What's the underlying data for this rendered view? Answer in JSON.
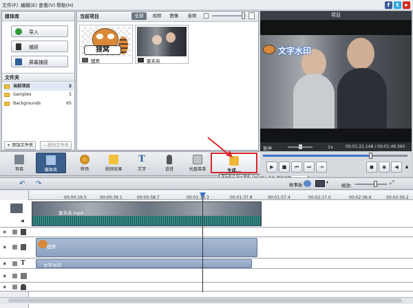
{
  "menu": {
    "items": [
      "文件(F)",
      "编辑(E)",
      "查看(V)",
      "帮助(H)"
    ]
  },
  "social": [
    {
      "name": "facebook",
      "letter": "f",
      "color": "#3b5998"
    },
    {
      "name": "twitter",
      "letter": "t",
      "color": "#2fa9e0"
    },
    {
      "name": "youtube",
      "letter": "▶",
      "color": "#d8281d"
    }
  ],
  "library": {
    "title": "媒体库",
    "buttons": [
      "导入",
      "捕获",
      "屏幕捕获"
    ],
    "folders_title": "文件夹",
    "folders": [
      {
        "name": "当前项目",
        "count": "2"
      },
      {
        "name": "Samples",
        "count": "5"
      },
      {
        "name": "Backgrounds",
        "count": "65"
      }
    ],
    "add_folder": "+ 添加文件夹",
    "delete_folder": "− 删除文件夹"
  },
  "project": {
    "title": "当前项目",
    "filters": [
      "全部",
      "视频",
      "图像",
      "音频"
    ],
    "items": [
      {
        "name": "狸窝",
        "overlay": "狸窝"
      },
      {
        "name": "夏未央"
      }
    ]
  },
  "preview": {
    "title": "项目",
    "watermark": "文字水印",
    "status": "暂停",
    "speed": "1x",
    "time": "00:01:21.148 / 00:01:49.360"
  },
  "toolbar": {
    "items": [
      "项目",
      "媒体库",
      "转场",
      "视频效果",
      "文字",
      "语音",
      "光盘菜单"
    ],
    "produce": "生成...",
    "tooltip": "保存影片到计算机,DVD/BD 光盘,移动设备。",
    "storyboard": "故事板",
    "zoom_label": "缩放:"
  },
  "timeline": {
    "ruler": [
      "00:00:19.5",
      "00:00:39.1",
      "00:00:58.7",
      "00:01:18.3",
      "00:01:37.8",
      "00:01:57.4",
      "00:02:17.0",
      "00:02:36.6",
      "00:02:56.2"
    ],
    "clips": {
      "video": "夏未央.mp4",
      "image": "狸窝",
      "text": "文字水印"
    }
  }
}
